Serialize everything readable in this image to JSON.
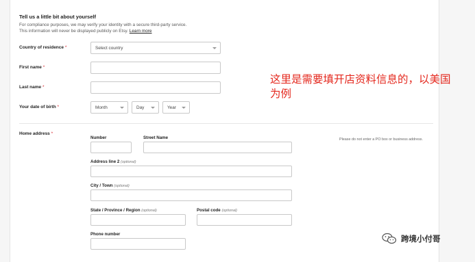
{
  "form": {
    "heading": "Tell us a little bit about yourself",
    "description_line1": "For compliance purposes, we may verify your identity with a secure third-party service.",
    "description_line2": "This information will never be displayed publicly on Etsy.",
    "learn_more": "Learn more",
    "required_mark": "*",
    "country": {
      "label": "Country of residence",
      "placeholder": "Select country"
    },
    "first_name": {
      "label": "First name",
      "value": ""
    },
    "last_name": {
      "label": "Last name",
      "value": ""
    },
    "dob": {
      "label": "Your date of birth",
      "month": "Month",
      "day": "Day",
      "year": "Year"
    },
    "address": {
      "label": "Home address",
      "note": "Please do not enter a PO box or business address.",
      "number": "Number",
      "street": "Street Name",
      "line2": "Address line 2",
      "city": "City / Town",
      "state": "State / Province / Region",
      "postal": "Postal code",
      "phone": "Phone number",
      "optional": "(optional)"
    }
  },
  "annotation": {
    "line1": "这里是需要填开店资料信息的，以美国",
    "line2": "为例",
    "color": "#e4281e"
  },
  "watermark": {
    "text": "跨境小付哥",
    "icon": "wechat-icon"
  }
}
